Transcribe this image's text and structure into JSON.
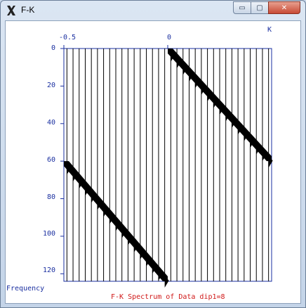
{
  "window": {
    "title": "F-K",
    "controls": {
      "minimize": "▭",
      "maximize": "▢",
      "close": "✕"
    }
  },
  "plot": {
    "x_axis_label": "K",
    "y_axis_label": "Frequency",
    "caption": "F-K Spectrum of Data dip1=8",
    "x_ticks": [
      "-0.5",
      "0"
    ],
    "y_ticks": [
      "0",
      "20",
      "40",
      "60",
      "80",
      "100",
      "120"
    ],
    "colors": {
      "axis": "#1a2fa0",
      "caption": "#d01818",
      "trace": "#000000"
    }
  },
  "chart_data": {
    "type": "wiggle",
    "x_range": [
      -0.5,
      0.5
    ],
    "y_range": [
      0,
      124
    ],
    "trace_count": 34,
    "events": [
      {
        "name": "",
        "k_start": 0.0,
        "f_start": 0,
        "k_end": 0.5,
        "f_end": 60
      },
      {
        "name": "",
        "k_start": -0.5,
        "f_start": 60,
        "k_end": 0.0,
        "f_end": 124
      }
    ]
  }
}
